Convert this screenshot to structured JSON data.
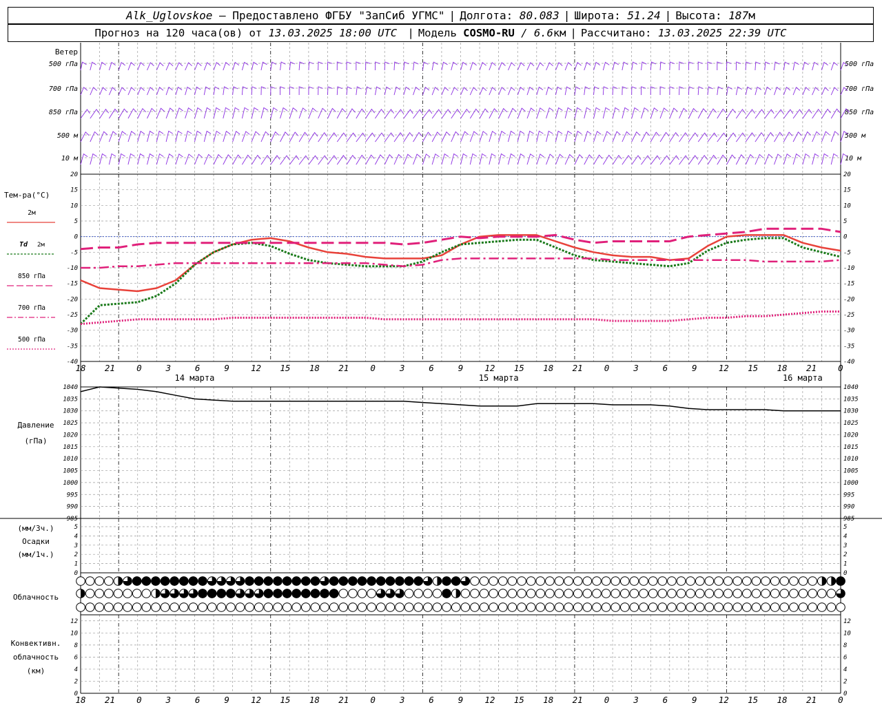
{
  "header": {
    "station": "Alk_Uglovskoe",
    "provider": "– Предоставлено ФГБУ \"ЗапСиб УГМС\"",
    "lon_label": "Долгота:",
    "lon_value": "80.083",
    "lat_label": "Широта:",
    "lat_value": "51.24",
    "alt_label": "Высота:",
    "alt_value": "187",
    "alt_unit": "м",
    "forecast_prefix": "Прогноз на 120 часа(ов) от",
    "forecast_time": "13.03.2025 18:00 UTC",
    "model_label": "Модель",
    "model_name": "COSMO-RU",
    "model_res": "/ 6.6",
    "model_res_unit": "км",
    "calc_label": "Рассчитано:",
    "calc_time": "13.03.2025 22:39 UTC"
  },
  "colors": {
    "wind": "#8a2be2",
    "t2m": "#e8423a",
    "td2m": "#1a7a1a",
    "t850": "#e0207a",
    "t700": "#e0207a",
    "t500": "#e0207a",
    "zero_line": "#2040c0",
    "pressure": "#000000",
    "grid": "#9a9a9a"
  },
  "chart_data": {
    "type": "line",
    "x_tick_labels": [
      "18",
      "21",
      "0",
      "3",
      "6",
      "9",
      "12",
      "15",
      "18",
      "21",
      "0",
      "3",
      "6",
      "9",
      "12",
      "15",
      "18",
      "21",
      "0",
      "3",
      "6",
      "9",
      "12",
      "15",
      "18",
      "21",
      "0"
    ],
    "day_labels": [
      {
        "label": "14 марта",
        "hour": 18
      },
      {
        "label": "15 марта",
        "hour": 66
      },
      {
        "label": "16 марта",
        "hour": 114
      }
    ],
    "wind": {
      "title": "Ветер",
      "levels": [
        "500 гПа",
        "700 гПа",
        "850 гПа",
        "500 м",
        "10  м"
      ],
      "barb_glyph": "⸍"
    },
    "temperature": {
      "title": "Тем-ра(°С)",
      "ylim": [
        -40,
        20
      ],
      "yticks": [
        20,
        15,
        10,
        5,
        0,
        -5,
        -10,
        -15,
        -20,
        -25,
        -30,
        -35,
        -40
      ],
      "legend": [
        {
          "key": "t2m",
          "label": "2м"
        },
        {
          "key": "td2m",
          "label_a": "Td",
          "label_b": "2м"
        },
        {
          "key": "t850",
          "label": "850 гПа"
        },
        {
          "key": "t700",
          "label": "700 гПа"
        },
        {
          "key": "t500",
          "label": "500 гПа"
        }
      ],
      "x_hours": [
        0,
        3,
        6,
        9,
        12,
        15,
        18,
        21,
        24,
        27,
        30,
        33,
        36,
        39,
        42,
        45,
        48,
        51,
        54,
        57,
        60,
        63,
        66,
        69,
        72,
        75,
        78,
        81,
        84,
        87,
        90,
        93,
        96,
        99,
        102,
        105,
        108,
        111,
        114,
        117,
        120
      ],
      "series": [
        {
          "key": "t2m",
          "values": [
            -14,
            -16.5,
            -17,
            -17.5,
            -16.5,
            -14,
            -9,
            -5,
            -2.5,
            -1,
            -0.5,
            -1.5,
            -3.5,
            -5,
            -5.5,
            -6.5,
            -7,
            -7,
            -7,
            -6,
            -2.5,
            0,
            0.5,
            0.5,
            0.5,
            -1.5,
            -3.5,
            -5,
            -6,
            -6.5,
            -6.5,
            -7.5,
            -7,
            -3,
            0,
            0.5,
            0.5,
            0.5,
            -2,
            -3.5,
            -4.5
          ]
        },
        {
          "key": "td2m",
          "values": [
            -28,
            -22,
            -21.5,
            -21,
            -19,
            -15,
            -9,
            -5,
            -2.5,
            -2,
            -3,
            -5.5,
            -7.5,
            -8.5,
            -9,
            -9.5,
            -9.5,
            -9.5,
            -8,
            -5,
            -2.5,
            -2,
            -1.5,
            -1,
            -1,
            -3.5,
            -6,
            -7.5,
            -8,
            -8.5,
            -9,
            -9.5,
            -8.5,
            -4.5,
            -2,
            -1,
            -0.5,
            -0.5,
            -3.5,
            -5,
            -6.5
          ]
        },
        {
          "key": "t850",
          "values": [
            -4,
            -3.5,
            -3.5,
            -2.5,
            -2,
            -2,
            -2,
            -2,
            -2,
            -2,
            -2,
            -2,
            -2,
            -2,
            -2,
            -2,
            -2,
            -2.5,
            -2,
            -1,
            0,
            -0.5,
            0,
            0,
            0,
            0.5,
            -1,
            -2,
            -1.5,
            -1.5,
            -1.5,
            -1.5,
            0,
            0.5,
            1,
            1.5,
            2.5,
            2.5,
            2.5,
            2.5,
            1.5
          ]
        },
        {
          "key": "t700",
          "values": [
            -10,
            -10,
            -9.5,
            -9.5,
            -9,
            -8.5,
            -8.5,
            -8.5,
            -8.5,
            -8.5,
            -8.5,
            -8.5,
            -8.5,
            -8.5,
            -8.5,
            -8.5,
            -9,
            -9.5,
            -9,
            -7.5,
            -7,
            -7,
            -7,
            -7,
            -7,
            -7,
            -7,
            -7,
            -7.5,
            -7.5,
            -7.5,
            -7.5,
            -7.5,
            -7.5,
            -7.5,
            -7.5,
            -8,
            -8,
            -8,
            -8,
            -7.5
          ]
        },
        {
          "key": "t500",
          "values": [
            -28,
            -27.5,
            -27,
            -26.5,
            -26.5,
            -26.5,
            -26.5,
            -26.5,
            -26,
            -26,
            -26,
            -26,
            -26,
            -26,
            -26,
            -26,
            -26.5,
            -26.5,
            -26.5,
            -26.5,
            -26.5,
            -26.5,
            -26.5,
            -26.5,
            -26.5,
            -26.5,
            -26.5,
            -26.5,
            -27,
            -27,
            -27,
            -27,
            -26.5,
            -26,
            -26,
            -25.5,
            -25.5,
            -25,
            -24.5,
            -24,
            -24
          ]
        }
      ]
    },
    "pressure": {
      "title_a": "Давление",
      "title_b": "(гПа)",
      "ylim": [
        985,
        1040
      ],
      "yticks": [
        1040,
        1035,
        1030,
        1025,
        1020,
        1015,
        1010,
        1005,
        1000,
        995,
        990,
        985
      ],
      "x_hours": [
        0,
        3,
        6,
        9,
        12,
        15,
        18,
        21,
        24,
        27,
        30,
        33,
        36,
        39,
        42,
        45,
        48,
        51,
        54,
        57,
        60,
        63,
        66,
        69,
        72,
        75,
        78,
        81,
        84,
        87,
        90,
        93,
        96,
        99,
        102,
        105,
        108,
        111,
        114,
        117,
        120
      ],
      "values": [
        1038,
        1040,
        1039.5,
        1039,
        1038,
        1036.5,
        1035,
        1034.5,
        1034,
        1034,
        1034,
        1034,
        1034,
        1034,
        1034,
        1034,
        1034,
        1034,
        1033.5,
        1033,
        1032.5,
        1032,
        1032,
        1032,
        1033,
        1033,
        1033,
        1033,
        1032.5,
        1032.5,
        1032.5,
        1032,
        1031,
        1030.5,
        1030.5,
        1030.5,
        1030.5,
        1030,
        1030,
        1030,
        1030
      ]
    },
    "precipitation": {
      "title_a": "(мм/3ч.)",
      "title_b": "Осадки",
      "title_c": "(мм/1ч.)",
      "ylim": [
        0,
        5
      ],
      "yticks": [
        5,
        4,
        3,
        2,
        1,
        0
      ],
      "values": []
    },
    "cloudiness": {
      "title": "Облачность",
      "rows": [
        "0000234444444433334444444434444444444324430000000000000000000000000000000000000224",
        "2000000023333444433344444444000033300004200000000000000000000000000000000000000003",
        "0000000000000000000000000000000000000000000000000000000000000000000000000000000000"
      ]
    },
    "convective": {
      "title_a": "Конвективн.",
      "title_b": "облачность",
      "title_c": "(км)",
      "ylim": [
        0,
        13
      ],
      "yticks": [
        12,
        10,
        8,
        6,
        4,
        2,
        0
      ],
      "values": []
    }
  }
}
